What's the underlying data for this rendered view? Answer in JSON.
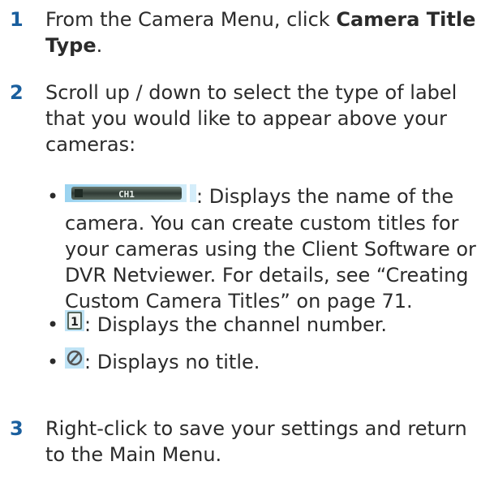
{
  "accent_color": "#1a5f9e",
  "steps": [
    {
      "number": "1",
      "pre": "From the Camera Menu, click ",
      "bold": "Camera Title Type",
      "post": "."
    },
    {
      "number": "2",
      "text": "Scroll up / down to select the type of label that you would like to appear above your cameras:"
    },
    {
      "number": "3",
      "text": "Right-click to save your settings and return to the Main Menu."
    }
  ],
  "bullets": [
    {
      "icon": "camera-name-label-icon",
      "icon_label": "CH1",
      "text": ": Displays the name of the camera. You can create custom titles for your cameras using the Client Software or DVR Netviewer. For details, see “Creating Custom Camera Titles” on page 71."
    },
    {
      "icon": "channel-number-label-icon",
      "icon_label": "1",
      "text": ": Displays the channel number."
    },
    {
      "icon": "no-title-icon",
      "text": ": Displays no title."
    }
  ]
}
